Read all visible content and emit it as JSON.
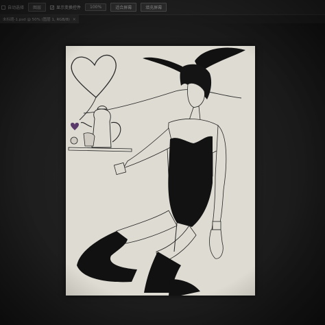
{
  "toolbar": {
    "auto_select_label": "自动选择",
    "layer_option": "图层",
    "show_transform_label": "显示变换控件",
    "zoom_value": "100%",
    "fit_screen_label": "适合屏幕",
    "fill_screen_label": "填充屏幕"
  },
  "document_tab": {
    "title": "未标题-1.psd @ 50% (图层 1, RGB/8)",
    "close_glyph": "×"
  },
  "artwork": {
    "description_icon": "illustration-canvas",
    "colors": {
      "paper": "#dedbd2",
      "ink": "#1a1a1a"
    }
  }
}
